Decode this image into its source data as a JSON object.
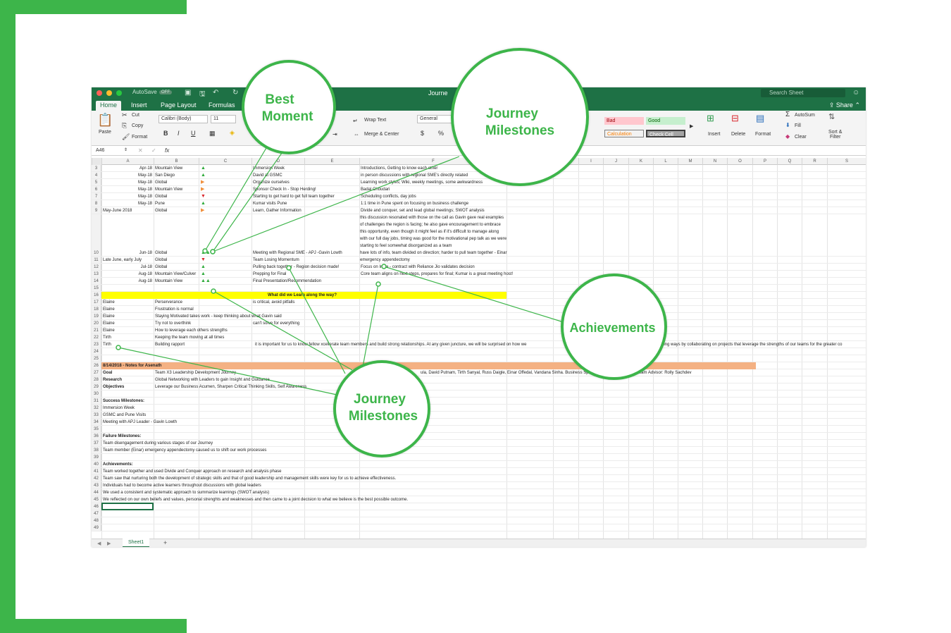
{
  "window": {
    "title": "Journe",
    "autosave": "AutoSave",
    "autosave_state": "OFF",
    "search_placeholder": "Search Sheet",
    "share_label": "Share"
  },
  "ribbon_tabs": [
    "Home",
    "Insert",
    "Page Layout",
    "Formulas"
  ],
  "ribbon": {
    "paste": "Paste",
    "cut": "Cut",
    "copy": "Copy",
    "format": "Format",
    "font_name": "Calibri (Body)",
    "font_size": "11",
    "bold": "B",
    "italic": "I",
    "underline": "U",
    "wrap_text": "Wrap Text",
    "merge_center": "Merge & Center",
    "number_format": "General",
    "currency": "$",
    "percent": "%",
    "style_bad": "Bad",
    "style_good": "Good",
    "style_calculation": "Calculation",
    "style_check_cell": "Check Cell",
    "insert": "Insert",
    "delete": "Delete",
    "format_cells": "Format",
    "autosum": "AutoSum",
    "fill": "Fill",
    "clear": "Clear",
    "sort_filter_1": "Sort &",
    "sort_filter_2": "Filter"
  },
  "formula_bar": {
    "name_box": "A46",
    "fx": "fx"
  },
  "columns": [
    "A",
    "B",
    "C",
    "D",
    "E",
    "F",
    "G",
    "H",
    "I",
    "J",
    "K",
    "L",
    "M",
    "N",
    "O",
    "P",
    "Q",
    "R",
    "S"
  ],
  "rows": {
    "r3": {
      "n": "3",
      "a": "Apr-18",
      "b": "Mountain View",
      "ind": "▲",
      "d": "Immersion Week",
      "e": "Introductions, Getting to know each other"
    },
    "r4": {
      "n": "4",
      "a": "May-18",
      "b": "San Diego",
      "ind": "▲",
      "d": "David at GSMC",
      "e": "in person discussions with regional SME's directly related"
    },
    "r5": {
      "n": "5",
      "a": "May-18",
      "b": "Global",
      "ind": "▶",
      "d": "Organize ourselves",
      "e": "Learning work styles; Wiki, weekly meetings, some awkwardness"
    },
    "r6": {
      "n": "6",
      "a": "May-18",
      "b": "Mountain View",
      "ind": "▶",
      "d": "Sponsor Check In - Stop Herding!",
      "e": "Badal Choudari"
    },
    "r7": {
      "n": "7",
      "a": "May-18",
      "b": "Global",
      "ind": "▼",
      "d": "Starting to get hard to get full team together",
      "e": "Scheduling conflicts, day jobs"
    },
    "r8": {
      "n": "8",
      "a": "May-18",
      "b": "Pune",
      "ind": "▲",
      "d": "Kumar visits Pune",
      "e": "1:1 time in Pune spent on focusing on business challenge"
    },
    "r9": {
      "n": "9",
      "a": "May-June 2018",
      "b": "Global",
      "ind": "▶",
      "d": "Learn, Gather Information",
      "e": "Divide and conquer, set and lead global meetings; SWOT analysis"
    },
    "r10": {
      "n": "10",
      "a": "Jun-18",
      "b": "Global",
      "ind": "▲▲",
      "d": "Meeting with Regional SME - APJ -Gavin Lowth",
      "e": "this discussion resonated with those on the call as Gavin gave real examples of challenges the region is facing; he also gave encouragement to embrace this opportunity, even though it might feel as if it's difficult to manage along with our full day jobs, timing was good for the motivational pep talk as we were starting to feel somewhat disorganized as a team"
    },
    "r11": {
      "n": "11",
      "a": "Late June, early July",
      "b": "Global",
      "ind": "▼",
      "d": "Team Losing Momentum",
      "e": "have lots of info, team divided on direction; harder to pull team together - Einar emergency appendectomy"
    },
    "r12": {
      "n": "12",
      "a": "Jul-18",
      "b": "Global",
      "ind": "▲",
      "d": "Pulling back together - Region decision made!",
      "e": "Focus on India - contract with Reliance Jio validates decision"
    },
    "r13": {
      "n": "13",
      "a": "Aug-18",
      "b": "Mountain View/Culver",
      "ind": "▲",
      "d": "Prepping for Final",
      "e": "Core team aligns on next steps, prepares for final; Kumar is a great meeting host!"
    },
    "r14": {
      "n": "14",
      "a": "Aug-18",
      "b": "Mountain View",
      "ind": "▲▲",
      "d": "Final Presentation/Recommendation",
      "e": ""
    },
    "r15": {
      "n": "15"
    },
    "r16": {
      "n": "16",
      "d": "What did we Learn along the way?"
    },
    "r17": {
      "n": "17",
      "a": "Elaine",
      "b": "Perserverance",
      "d": "is critical, avoid pitfalls"
    },
    "r18": {
      "n": "18",
      "a": "Elaine",
      "b": "Frustration is normal"
    },
    "r19": {
      "n": "19",
      "a": "Elaine",
      "b": "Staying Motivated takes work - keep thinking about what Gavin said"
    },
    "r20": {
      "n": "20",
      "a": "Elaine",
      "b": "Try not to overthink",
      "d": "can't solve for everything"
    },
    "r21": {
      "n": "21",
      "a": "Elaine",
      "b": "How to leverage each others strengths"
    },
    "r22": {
      "n": "22",
      "a": "Tirth",
      "b": "Keeping the team moving at all times"
    },
    "r23": {
      "n": "23",
      "a": "Tirth",
      "b": "Building rapport",
      "d": "it is important for us to know fellow xcellerate team members and build strong relationships. At any given juncture, we will be surprised on how we",
      "k": "ising ways by collaborating on projects that leverage the strengths of our teams for the greater co"
    },
    "r24": {
      "n": "24"
    },
    "r25": {
      "n": "25"
    },
    "r26": {
      "n": "26",
      "a": "8/14/2018 - Notes for Asenath"
    },
    "r27": {
      "n": "27",
      "a": "Goal",
      "b": "Team X3 Leadership Development Journey",
      "g": "ula, David Putnam, Tirth Sanyal, Russ Daigle, Einar Offedal, Vandana Sinha.  Business Sponsor - Badal Choudhari.  Team Advisor:  Rolly Sachdev"
    },
    "r28": {
      "n": "28",
      "a": "Research",
      "b": "Global Networking with Leaders to gain Insight and Guidance"
    },
    "r29": {
      "n": "29",
      "a": "Objectives",
      "b": "Leverage our Business Acumen, Sharpen Critical Thinking Skills, Self Awareness"
    },
    "r30": {
      "n": "30"
    },
    "r31": {
      "n": "31",
      "a": "Success Milestones:"
    },
    "r32": {
      "n": "32",
      "a": "Immersion Week"
    },
    "r33": {
      "n": "33",
      "a": "GSMC and Pune Visits"
    },
    "r34": {
      "n": "34",
      "a": "Meeting with APJ Leader - Gavin Lowth"
    },
    "r35": {
      "n": "35"
    },
    "r36": {
      "n": "36",
      "a": "Failure Milestones:"
    },
    "r37": {
      "n": "37",
      "a": "Team disengagement during various stages of our Journey"
    },
    "r38": {
      "n": "38",
      "a": "Team member (Einar) emergency appendectomy caused us to shift our work processes"
    },
    "r39": {
      "n": "39"
    },
    "r40": {
      "n": "40",
      "a": "Achievements:"
    },
    "r41": {
      "n": "41",
      "a": "Team worked together and used Divide and Conquer approach on research and analysis phase"
    },
    "r42": {
      "n": "42",
      "a": "Team saw that nurturing both the development of strategic skills and that of good leadership and management skills were key for us to achieve effectiveness."
    },
    "r43": {
      "n": "43",
      "a": "Individuals had to become active learners throughout discussions with global leaders"
    },
    "r44": {
      "n": "44",
      "a": "We used a consistent and systematic approach to summarize learnings (SWOT analysis)"
    },
    "r45": {
      "n": "45",
      "a": "We reflected on our own beliefs and values, personal strenghts and weaknesses and then came to a joint decision to what we believe is the best possible outcome."
    },
    "r46": {
      "n": "46"
    },
    "r47": {
      "n": "47"
    },
    "r48": {
      "n": "48"
    },
    "r49": {
      "n": "49"
    }
  },
  "sheet_tab": "Sheet1",
  "add_sheet": "+",
  "callouts": {
    "best_moment_1": "Best",
    "best_moment_2": "Moment",
    "journey_top_1": "Journey",
    "journey_top_2": "Milestones",
    "achievements": "Achievements",
    "journey_bottom_1": "Journey",
    "journey_bottom_2": "Milestones"
  },
  "colors": {
    "accent": "#3db54a",
    "excel_green": "#1e7145",
    "highlight_yellow": "#ffff00",
    "highlight_orange": "#f4b183"
  }
}
